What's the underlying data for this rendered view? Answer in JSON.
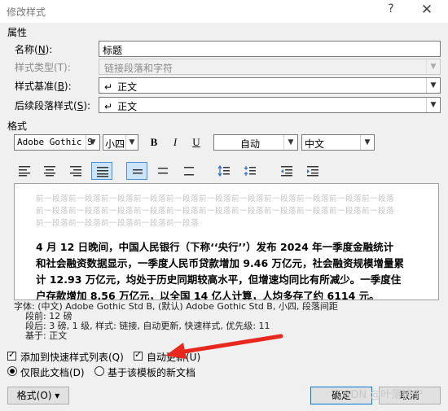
{
  "window": {
    "title": "修改样式",
    "help": "?",
    "close": "✕"
  },
  "properties": {
    "section_label": "属性",
    "name_label": "名称(",
    "name_key": "N",
    "name_label_end": "):",
    "name_value": "标题",
    "type_label": "样式类型(T):",
    "type_value": "链接段落和字符",
    "based_label": "样式基准(",
    "based_key": "B",
    "based_label_end": "):",
    "based_value": "正文",
    "next_label": "后续段落样式(",
    "next_key": "S",
    "next_label_end": "):",
    "next_value": "正文",
    "enter_symbol": "↵"
  },
  "format": {
    "section_label": "格式",
    "font_latin": "Adobe Gothic S",
    "font_size": "小四",
    "bold": "B",
    "italic": "I",
    "underline": "U",
    "color": "自动",
    "lang": "中文",
    "active_align_index": 3,
    "active_spacing_index": 0
  },
  "preview": {
    "ghost_lines": [
      "前一段落前一段落前一段落前一段落前一段落前一段落前一段落前一段落前一段落前一段落前一段落",
      "前一段落前一段落前一段落前一段落前一段落前一段落前一段落前一段落前一段落前一段落前一段落",
      "前一段落前一段落前一段落前一段落前一段落"
    ],
    "sample_lines": [
      "4 月 12 日晚间，中国人民银行（下称‘‘央行’’）发布 2024 年一季度金融统计",
      "和社会融资数据显示，一季度人民币贷款增加 9.46 万亿元，社会融资规模增量累",
      "计 12.93 万亿元，均处于历史同期较高水平，但增速均同比有所减少。一季度住",
      "户存款增加 8.56 万亿元，以全国 14 亿人计算，人均多存了约 6114 元。"
    ]
  },
  "description": {
    "lines": [
      "字体: (中文) Adobe Gothic Std B, (默认) Adobe Gothic Std B, 小四, 段落间距",
      "    段前: 12 磅",
      "    段后: 3 磅, 1 级, 样式: 链接, 自动更新, 快速样式, 优先级: 11",
      "    基于: 正文"
    ]
  },
  "options": {
    "add_quick_label": "添加到快速样式列表(Q)",
    "add_quick_checked": true,
    "auto_update_label": "自动更新(U)",
    "auto_update_checked": true,
    "only_doc_label": "仅限此文档(D)",
    "template_label": "基于该模板的新文档"
  },
  "buttons": {
    "format": "格式(O)",
    "format_arrow": "▾",
    "ok": "确定",
    "cancel": "取消"
  },
  "watermark": "CSDN @叶落情宁"
}
